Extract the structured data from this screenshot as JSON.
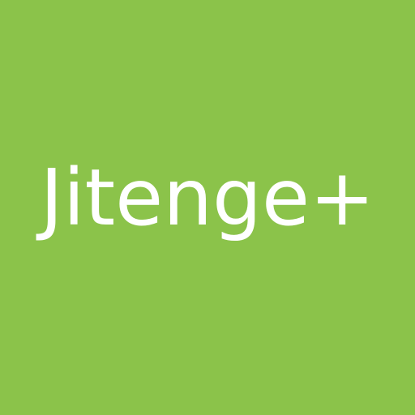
{
  "app": {
    "name": "Jitenge+"
  },
  "colors": {
    "background": "#8bc34a",
    "text": "#ffffff"
  }
}
